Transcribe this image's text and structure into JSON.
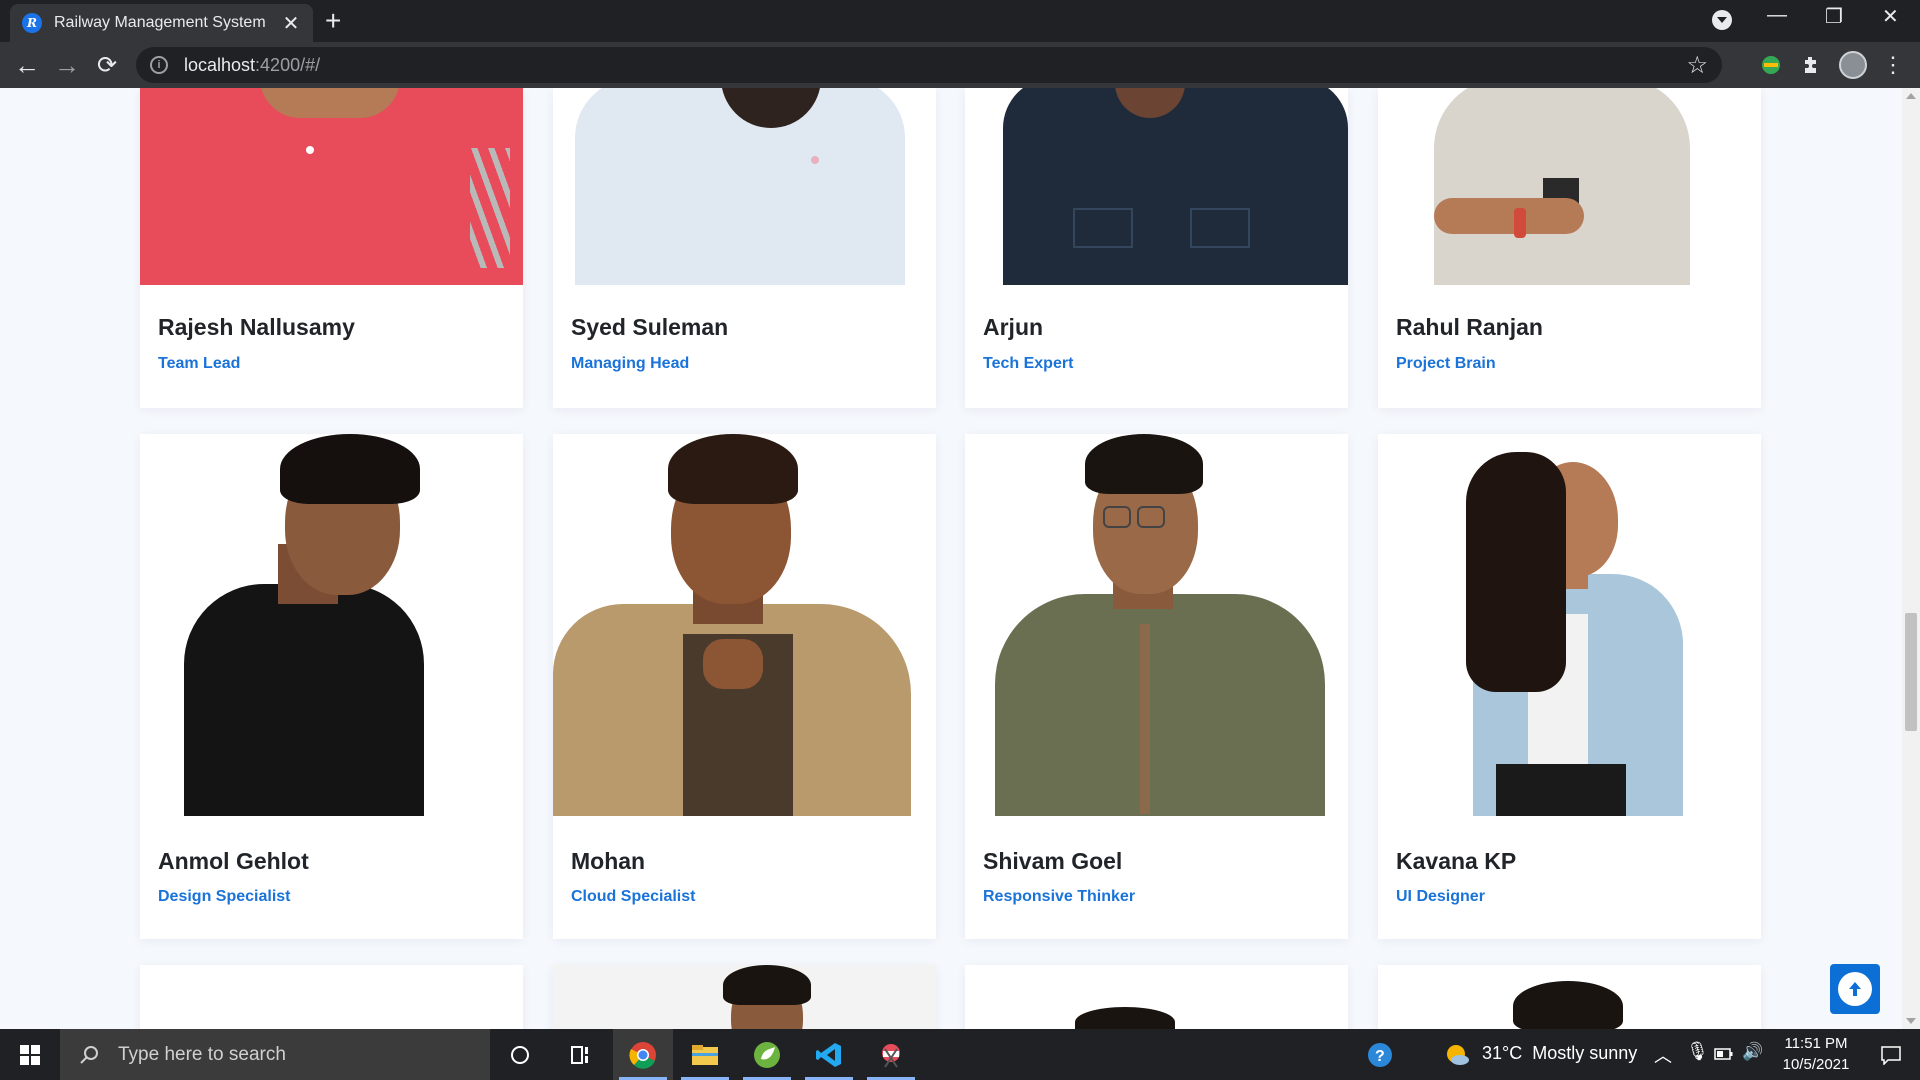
{
  "browser": {
    "tab_title": "Railway Management System",
    "tab_favicon": "R",
    "url_host": "localhost",
    "url_rest": ":4200/#/"
  },
  "team": [
    {
      "name": "Rajesh Nallusamy",
      "role": "Team Lead"
    },
    {
      "name": "Syed Suleman",
      "role": "Managing Head"
    },
    {
      "name": "Arjun",
      "role": "Tech Expert"
    },
    {
      "name": "Rahul Ranjan",
      "role": "Project Brain"
    },
    {
      "name": "Anmol Gehlot",
      "role": "Design Specialist"
    },
    {
      "name": "Mohan",
      "role": "Cloud Specialist"
    },
    {
      "name": "Shivam Goel",
      "role": "Responsive Thinker"
    },
    {
      "name": "Kavana KP",
      "role": "UI Designer"
    }
  ],
  "taskbar": {
    "search_placeholder": "Type here to search",
    "weather": "31°C  Mostly sunny",
    "time": "11:51 PM",
    "date": "10/5/2021"
  },
  "icons": {
    "back": "arrow-left-icon",
    "forward": "arrow-right-icon",
    "reload": "reload-icon",
    "bookmark": "star-icon",
    "extensions": "puzzle-icon",
    "scroll_top": "arrow-up-circle-icon"
  },
  "colors": {
    "accent": "#1a73d9",
    "page_bg": "#f5f8fc",
    "fab": "#0c6fd6"
  }
}
